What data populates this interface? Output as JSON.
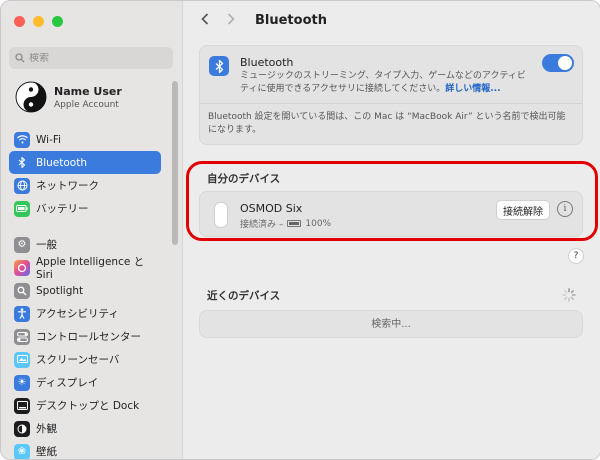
{
  "window": {
    "title": "Bluetooth"
  },
  "sidebar": {
    "search_placeholder": "検索",
    "user": {
      "name": "Name User",
      "subtitle": "Apple Account"
    },
    "items": [
      {
        "label": "Wi-Fi",
        "icon": "wifi-icon",
        "color": "#3a7bdd"
      },
      {
        "label": "Bluetooth",
        "icon": "bluetooth-icon",
        "color": "#3a7bdd",
        "active": true
      },
      {
        "label": "ネットワーク",
        "icon": "globe-icon",
        "color": "#3a7bdd"
      },
      {
        "label": "バッテリー",
        "icon": "battery-icon",
        "color": "#34c759"
      },
      {
        "label": "一般",
        "icon": "gear-icon",
        "color": "#8e8e93"
      },
      {
        "label": "Apple Intelligence と Siri",
        "icon": "siri-icon",
        "color": "#b25bd6"
      },
      {
        "label": "Spotlight",
        "icon": "search-icon",
        "color": "#8e8e93"
      },
      {
        "label": "アクセシビリティ",
        "icon": "accessibility-icon",
        "color": "#3a7bdd"
      },
      {
        "label": "コントロールセンター",
        "icon": "control-center-icon",
        "color": "#8e8e93"
      },
      {
        "label": "スクリーンセーバ",
        "icon": "screensaver-icon",
        "color": "#5ac8fa"
      },
      {
        "label": "ディスプレイ",
        "icon": "sun-icon",
        "color": "#3a7bdd"
      },
      {
        "label": "デスクトップと Dock",
        "icon": "dock-icon",
        "color": "#1c1c1e"
      },
      {
        "label": "外観",
        "icon": "appearance-icon",
        "color": "#1c1c1e"
      },
      {
        "label": "壁紙",
        "icon": "wallpaper-icon",
        "color": "#5ac8fa"
      }
    ]
  },
  "main": {
    "bluetooth": {
      "name": "Bluetooth",
      "description": "ミュージックのストリーミング、タイプ入力、ゲームなどのアクティビティに使用できるアクセサリに接続してください。",
      "more_link": "詳しい情報...",
      "toggle_on": true,
      "note": "Bluetooth 設定を開いている間は、この Mac は “MacBook Air” という名前で検出可能になります。"
    },
    "my_devices": {
      "label": "自分のデバイス",
      "device": {
        "name": "OSMOD Six",
        "status": "接続済み –",
        "battery": "100%",
        "disconnect_label": "接続解除",
        "info_glyph": "i"
      },
      "highlight_color": "#e30000"
    },
    "help_glyph": "?",
    "nearby": {
      "label": "近くのデバイス",
      "searching": "検索中..."
    }
  }
}
